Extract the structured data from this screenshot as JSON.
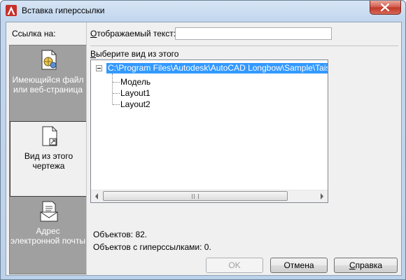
{
  "window": {
    "title": "Вставка гиперссылки",
    "app_icon": "autocad-logo-icon",
    "close_icon": "close-icon",
    "accent_color": "#c8302a"
  },
  "link_to": {
    "label": "Ссылка на:",
    "items": [
      {
        "label_line1": "Имеющийся файл",
        "label_line2": "или веб-страница",
        "icon": "file-globe-icon",
        "selected": false
      },
      {
        "label_line1": "Вид из этого",
        "label_line2": "чертежа",
        "icon": "drawing-view-icon",
        "selected": true
      },
      {
        "label_line1": "Адрес",
        "label_line2": "электронной почты",
        "icon": "email-icon",
        "selected": false
      }
    ]
  },
  "display_text": {
    "label_first": "О",
    "label_rest": "тображаемый текст:",
    "value": ""
  },
  "view_select": {
    "label_first": "В",
    "label_rest": "ыберите вид из этого",
    "root": "C:\\Program Files\\Autodesk\\AutoCAD Longbow\\Sample\\Taisei Detai",
    "children": [
      "Модель",
      "Layout1",
      "Layout2"
    ]
  },
  "counts": {
    "objects": "Объектов: 82.",
    "hyperlinked": "Объектов с гиперссылками: 0."
  },
  "buttons": {
    "ok": "OK",
    "cancel": "Отмена",
    "help_first": "С",
    "help_rest": "правка"
  }
}
